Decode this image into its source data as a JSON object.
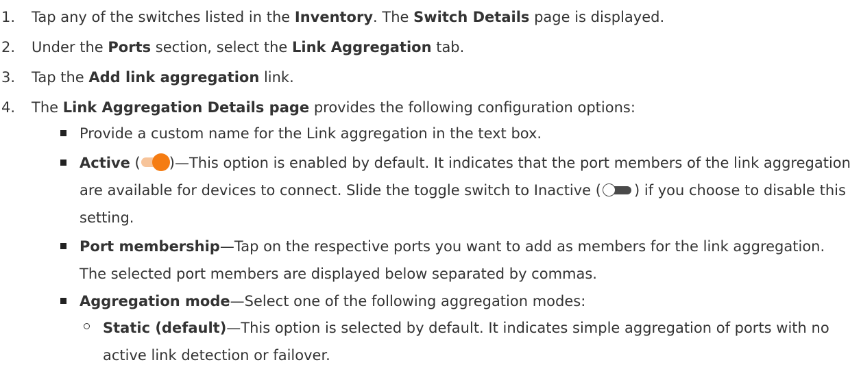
{
  "steps": [
    {
      "num": "1.",
      "parts": [
        "Tap any of the switches listed in the ",
        "Inventory",
        ". The ",
        "Switch Details",
        " page is displayed."
      ]
    },
    {
      "num": "2.",
      "parts": [
        "Under the ",
        "Ports",
        " section, select the ",
        "Link Aggregation",
        " tab."
      ]
    },
    {
      "num": "3.",
      "parts": [
        "Tap the ",
        "Add link aggregation",
        " link."
      ]
    },
    {
      "num": "4.",
      "parts": [
        "The ",
        "Link Aggregation Details page",
        " provides the following configuration options:"
      ]
    }
  ],
  "bullets": {
    "name": "Provide a custom name for the Link aggregation in the text box.",
    "active_label": "Active",
    "active_open": " (",
    "active_text": ")—This option is enabled by default. It indicates that the port members of the link aggregation are available for devices to connect. Slide the toggle switch to Inactive (",
    "active_tail": ") if you choose to disable this setting.",
    "port_label": "Port membership",
    "port_text": "—Tap on the respective ports you want to add as members for the link aggregation. The selected port members are displayed below separated by commas.",
    "mode_label": "Aggregation mode",
    "mode_text": "—Select one of the following aggregation modes:"
  },
  "sub_bullets": {
    "static_label": "Static (default)",
    "static_text": "—This option is selected by default. It indicates simple aggregation of ports with no active link detection or failover."
  },
  "colors": {
    "toggle_on_knob": "#f57c12",
    "toggle_on_track": "#f7c49a",
    "toggle_off_track": "#4a4a4a"
  },
  "icons": [
    "toggle-on-icon",
    "toggle-off-icon"
  ]
}
